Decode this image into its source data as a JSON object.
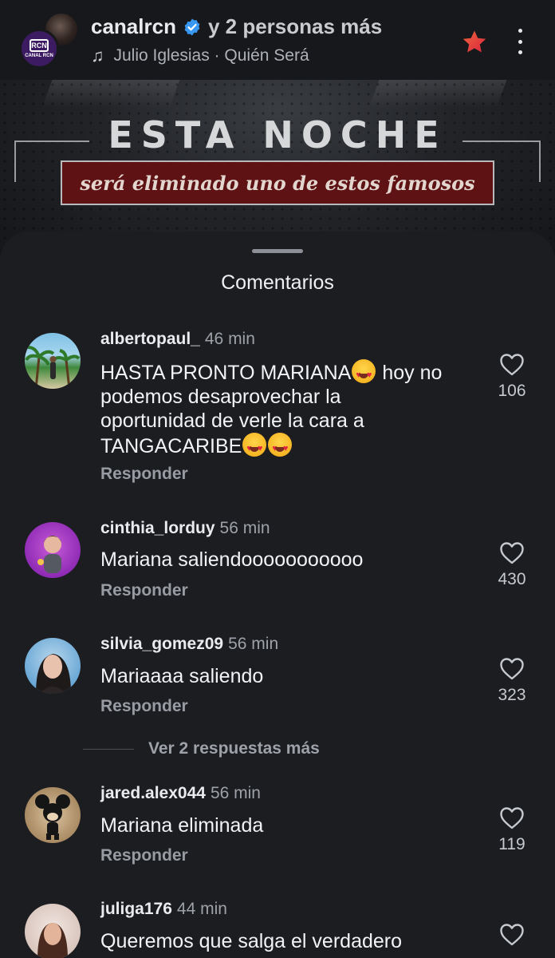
{
  "header": {
    "account_name": "canalrcn",
    "others_text": "y 2 personas más",
    "music_artist_song": "Julio Iglesias · Quién Será",
    "channel_logo_text": "CANAL RCN"
  },
  "banner": {
    "title": "ESTA NOCHE",
    "subtitle": "será eliminado uno de estos famosos"
  },
  "comments_sheet": {
    "title": "Comentarios",
    "comments": [
      {
        "username": "albertopaul_",
        "time": "46 min",
        "text_line1": "HASTA PRONTO MARIANA",
        "text_line1_after": " hoy no",
        "text_line2": "podemos desaprovechar la",
        "text_line3": "oportunidad de verle la cara a",
        "text_line4": "TANGACARIBE",
        "reply_label": "Responder",
        "likes": "106"
      },
      {
        "username": "cinthia_lorduy",
        "time": "56 min",
        "text": "Mariana saliendooooooooooo",
        "reply_label": "Responder",
        "likes": "430"
      },
      {
        "username": "silvia_gomez09",
        "time": "56 min",
        "text": "Mariaaaa saliendo",
        "reply_label": "Responder",
        "likes": "323"
      },
      {
        "username": "jared.alex044",
        "time": "56 min",
        "text": "Mariana eliminada",
        "reply_label": "Responder",
        "likes": "119"
      },
      {
        "username": "juliga176",
        "time": "44 min",
        "text": "Queremos que salga el verdadero"
      }
    ],
    "more_replies_label": "Ver 2 respuestas más"
  },
  "colors": {
    "sheet_bg": "#1b1d21",
    "banner_red": "#5e1214",
    "verified_blue": "#3897f0",
    "star_red": "#e8403a"
  }
}
